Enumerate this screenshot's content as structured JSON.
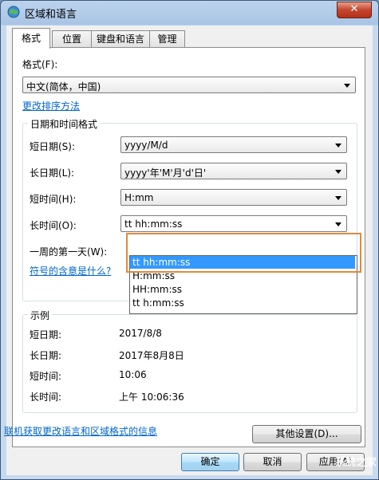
{
  "window": {
    "title": "区域和语言",
    "close_glyph": "✕"
  },
  "tabs": [
    {
      "label": "格式",
      "active": true
    },
    {
      "label": "位置",
      "active": false
    },
    {
      "label": "键盘和语言",
      "active": false
    },
    {
      "label": "管理",
      "active": false
    }
  ],
  "format": {
    "label": "格式(F):",
    "value": "中文(简体，中国)",
    "sort_link": "更改排序方法"
  },
  "datetime_group": {
    "title": "日期和时间格式",
    "short_date": {
      "label": "短日期(S):",
      "value": "yyyy/M/d"
    },
    "long_date": {
      "label": "长日期(L):",
      "value": "yyyy'年'M'月'd'日'"
    },
    "short_time": {
      "label": "短时间(H):",
      "value": "H:mm"
    },
    "long_time": {
      "label": "长时间(O):",
      "value": "tt hh:mm:ss"
    },
    "first_day": {
      "label": "一周的第一天(W):"
    },
    "symbol_link": "符号的含意是什么?",
    "dropdown_options": [
      "tt hh:mm:ss",
      "H:mm:ss",
      "HH:mm:ss",
      "tt h:mm:ss"
    ]
  },
  "example_group": {
    "title": "示例",
    "rows": [
      {
        "label": "短日期:",
        "value": "2017/8/8"
      },
      {
        "label": "长日期:",
        "value": "2017年8月8日"
      },
      {
        "label": "短时间:",
        "value": "10:06"
      },
      {
        "label": "长时间:",
        "value": "上午 10:06:36"
      }
    ]
  },
  "buttons": {
    "other_settings": "其他设置(D)...",
    "ok": "确定",
    "cancel": "取消",
    "apply": "应用(A)"
  },
  "online_link": "联机获取更改语言和区域格式的信息",
  "watermark": "系统之家"
}
